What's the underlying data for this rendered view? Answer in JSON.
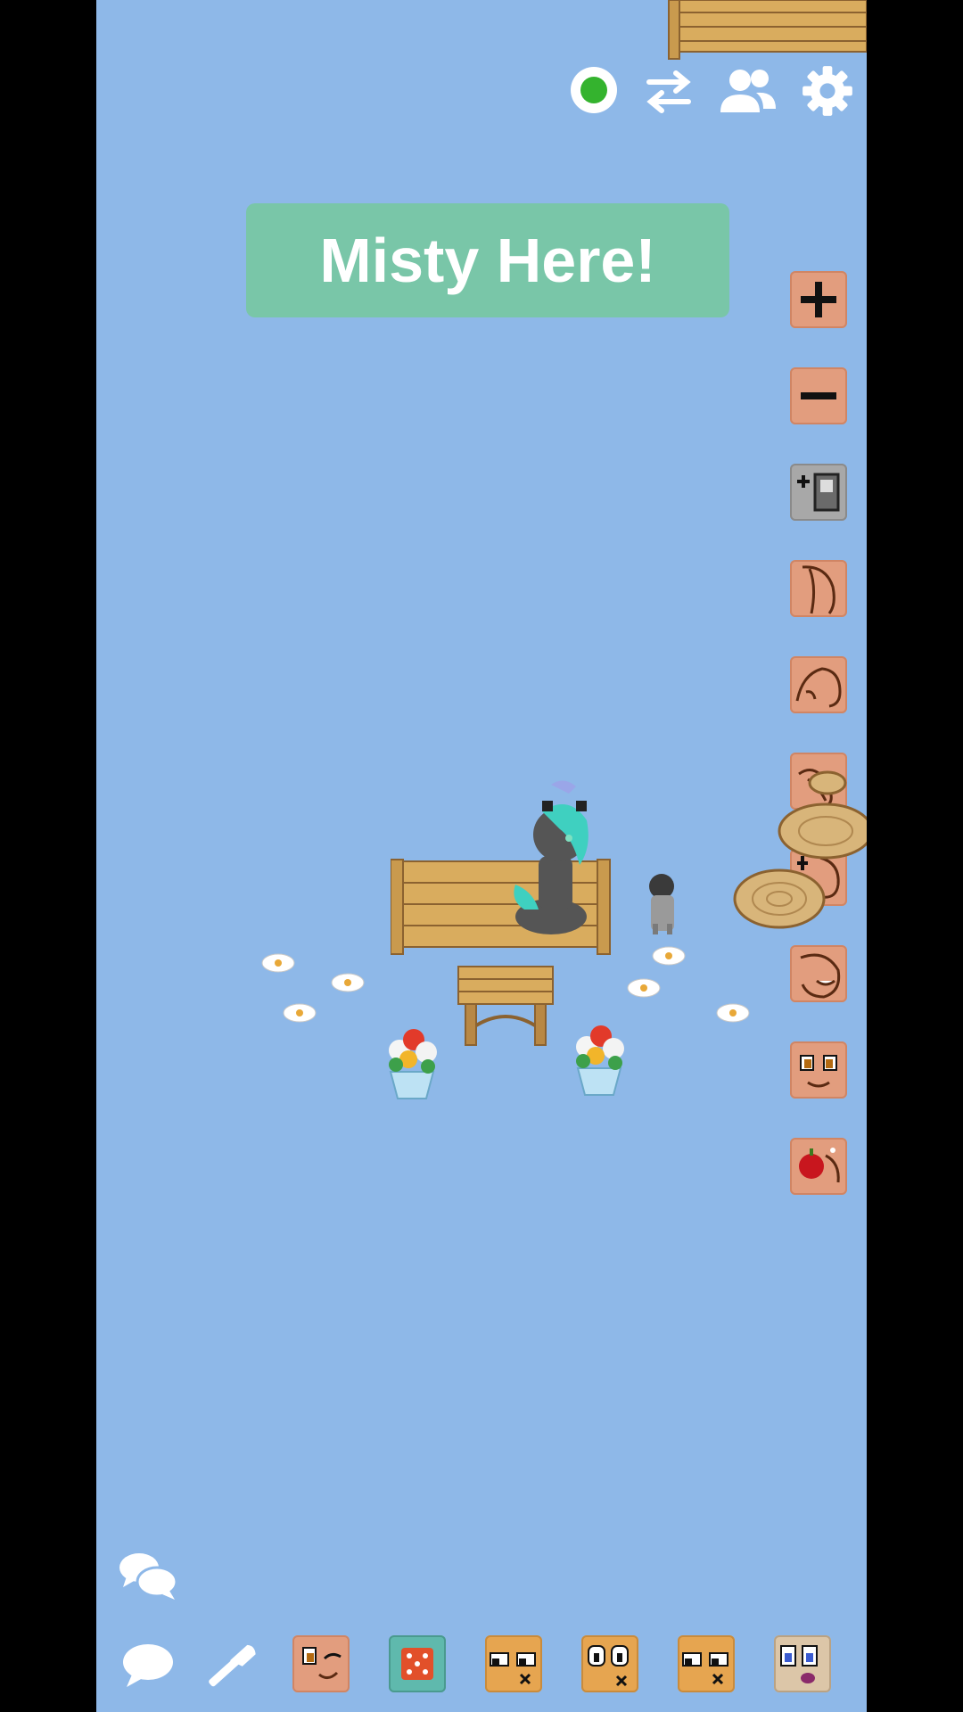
{
  "banner": {
    "text": "Misty Here!"
  },
  "colors": {
    "sky": "#8eb8e8",
    "online": "#34b32e",
    "banner_bg": "#79c6a8",
    "side_button": "#e29d7e",
    "bottom_button": "#e6a550"
  },
  "top_bar": {
    "icons": [
      "online-status-icon",
      "swap-icon",
      "friends-icon",
      "settings-icon"
    ]
  },
  "side_toolbar": {
    "icons": [
      "zoom-in-icon",
      "zoom-out-icon",
      "pose-gray-icon",
      "pony-ear-icon",
      "pony-lie-icon",
      "pony-hoof-icon",
      "pony-arrows-icon",
      "pony-smile-icon",
      "pony-face-icon",
      "apple-icon"
    ]
  },
  "bottom_bar": {
    "icons": [
      "chat-icon",
      "build-hammer-icon",
      "wink-face-icon",
      "dice-icon",
      "face-x-icon",
      "face-eyes-icon",
      "face-x2-icon",
      "face-tongue-icon"
    ]
  },
  "chat_log_icon": "chat-log-icon"
}
